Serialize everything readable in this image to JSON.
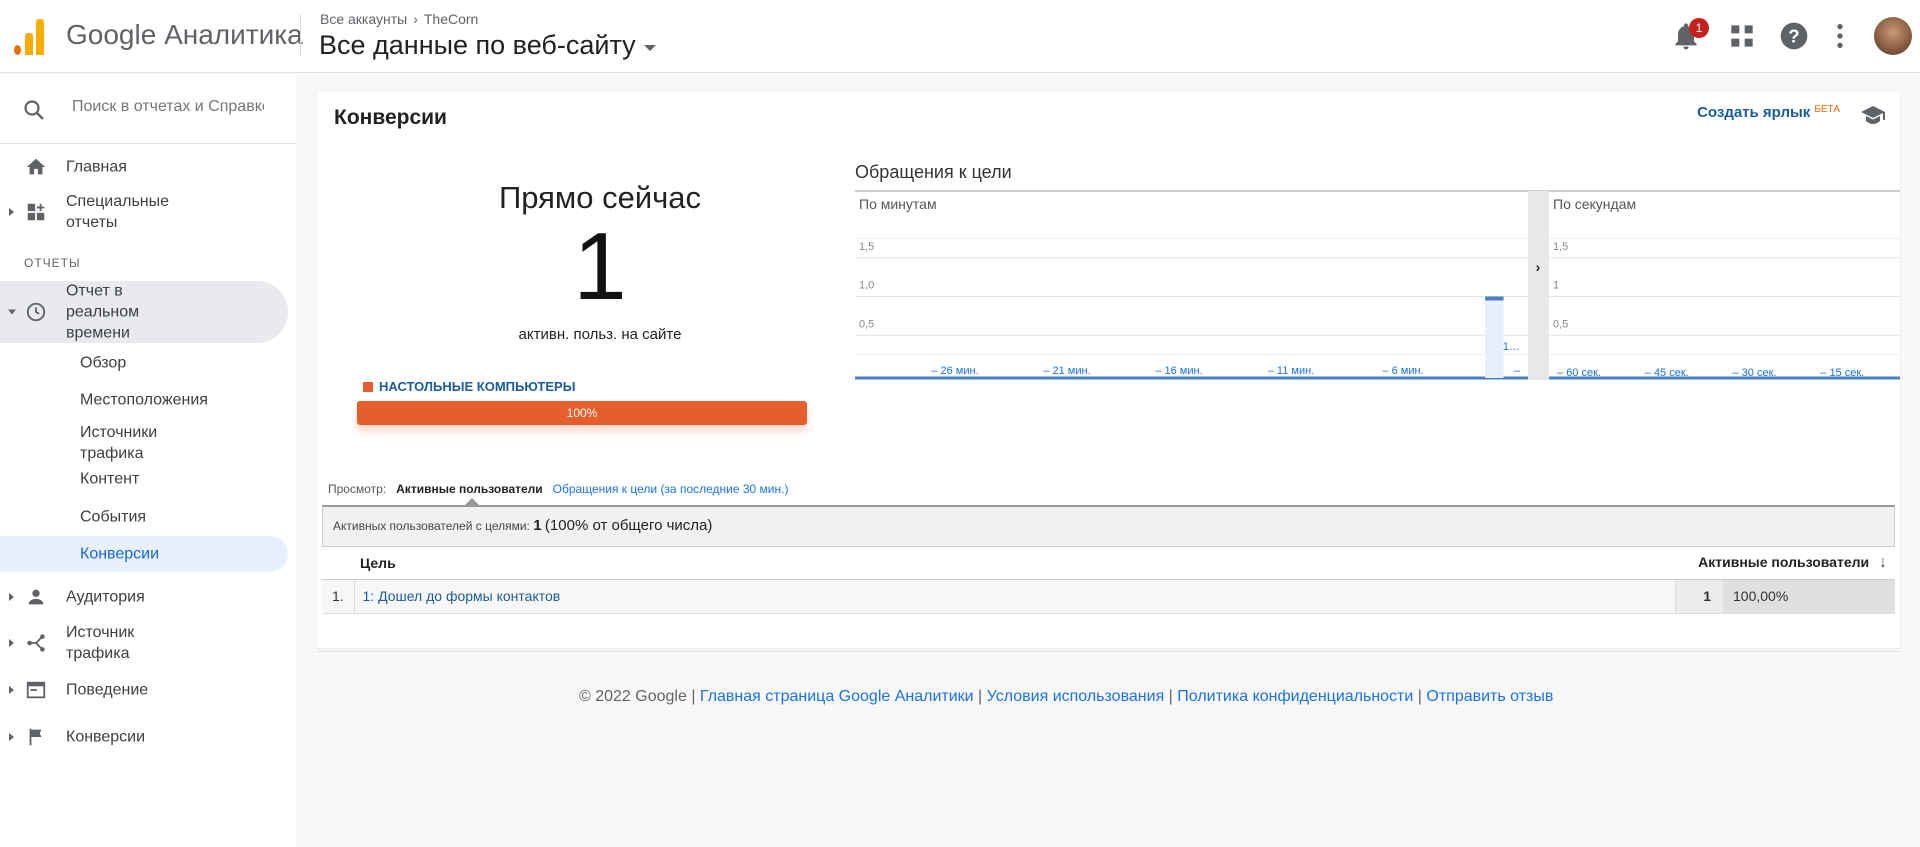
{
  "header": {
    "app_name": "Google Аналитика",
    "breadcrumb": [
      "Все аккаунты",
      "TheCorn"
    ],
    "property": "Все данные по веб-сайту",
    "notification_count": "1"
  },
  "sidebar": {
    "search_placeholder": "Поиск в отчетах и Справке",
    "home": "Главная",
    "custom_reports": "Специальные отчеты",
    "section_title": "ОТЧЕТЫ",
    "realtime": "Отчет в реальном времени",
    "realtime_items": [
      "Обзор",
      "Местоположения",
      "Источники трафика",
      "Контент",
      "События",
      "Конверсии"
    ],
    "audience": "Аудитория",
    "acquisition": "Источник трафика",
    "behavior": "Поведение",
    "conversions": "Конверсии"
  },
  "main": {
    "title": "Конверсии",
    "shortcut": "Создать ярлык",
    "beta": "БЕТА",
    "right_now_title": "Прямо сейчас",
    "right_now_value": "1",
    "right_now_label": "активн. польз. на сайте",
    "device_label": "НАСТОЛЬНЫЕ КОМПЬЮТЕРЫ",
    "device_percent": "100%",
    "device_share": 1.0,
    "view_label": "Просмотр:",
    "view_active": "Активные пользователи",
    "view_other": "Обращения к цели (за последние 30 мин.)",
    "summary_label": "Активных пользователей с целями:",
    "summary_value": "1",
    "summary_pct": "(100% от общего числа)",
    "table": {
      "col_goal": "Цель",
      "col_users": "Активные пользователи",
      "rows": [
        {
          "index": "1.",
          "goal": "1: Дошел до формы контактов",
          "users": "1",
          "pct": "100,00%"
        }
      ]
    }
  },
  "chart_data": [
    {
      "type": "bar",
      "title": "Обращения к цели",
      "subtitle": "По минутам",
      "yticks": [
        "0,5",
        "1,0",
        "1,5"
      ],
      "ylim": [
        0,
        2
      ],
      "xticks": [
        "– 26 мин.",
        "– 21 мин.",
        "– 16 мин.",
        "– 11 мин.",
        "– 6 мин.",
        "1…",
        "–"
      ],
      "categories_count": 30,
      "values": [
        0,
        0,
        0,
        0,
        0,
        0,
        0,
        0,
        0,
        0,
        0,
        0,
        0,
        0,
        0,
        0,
        0,
        0,
        0,
        0,
        0,
        0,
        0,
        0,
        0,
        0,
        0,
        0,
        1,
        0
      ],
      "bar_color": "#4a7fc1"
    },
    {
      "type": "bar",
      "subtitle": "По секундам",
      "yticks": [
        "0,5",
        "1",
        "1,5"
      ],
      "ylim": [
        0,
        2
      ],
      "xticks": [
        "– 60 сек.",
        "– 45 сек.",
        "– 30 сек.",
        "– 15 сек."
      ],
      "values": [],
      "bar_color": "#4a7fc1"
    }
  ],
  "footer": {
    "copyright": "© 2022 Google",
    "links": [
      "Главная страница Google Аналитики",
      "Условия использования",
      "Политика конфиденциальности",
      "Отправить отзыв"
    ]
  }
}
